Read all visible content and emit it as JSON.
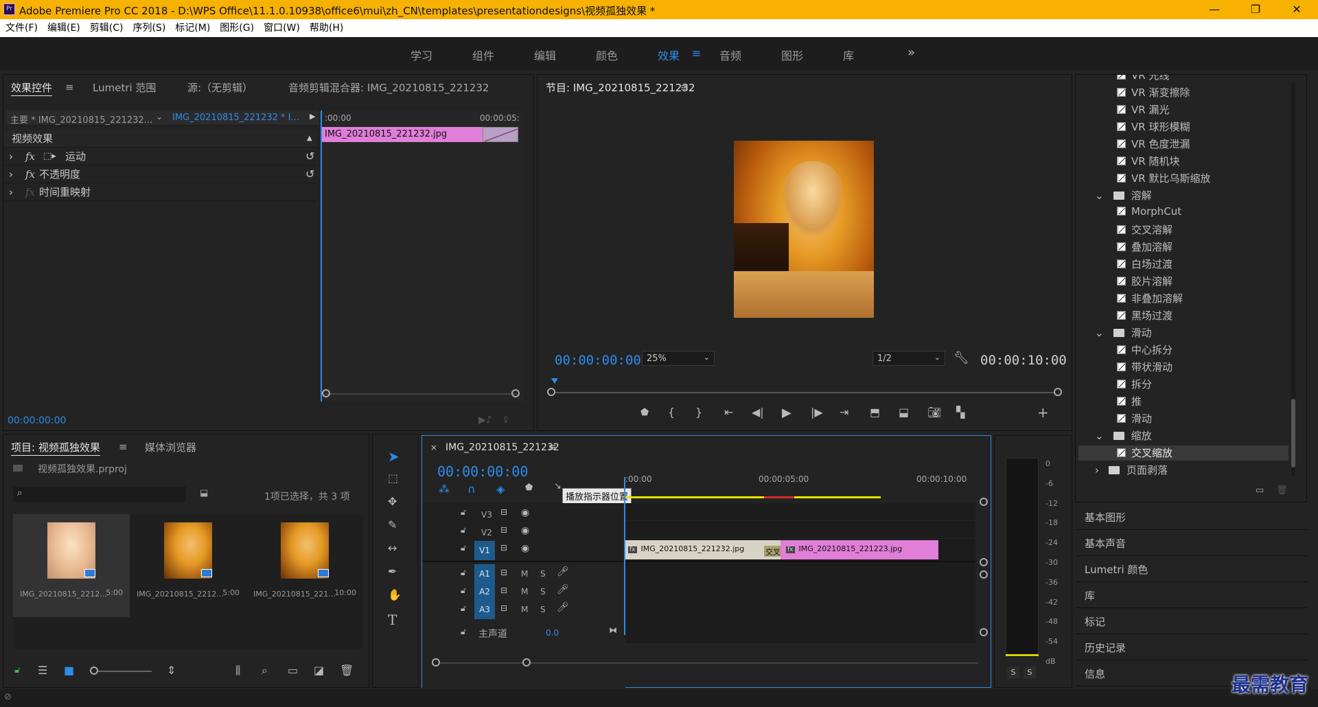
{
  "app": {
    "title": "Adobe Premiere Pro CC 2018 - D:\\WPS Office\\11.1.0.10938\\office6\\mui\\zh_CN\\templates\\presentationdesigns\\视频孤独效果 *",
    "icon_label": "Pr"
  },
  "menu": [
    "文件(F)",
    "编辑(E)",
    "剪辑(C)",
    "序列(S)",
    "标记(M)",
    "图形(G)",
    "窗口(W)",
    "帮助(H)"
  ],
  "workspaces": [
    "学习",
    "组件",
    "编辑",
    "颜色",
    "效果",
    "音频",
    "图形",
    "库"
  ],
  "active_workspace": "效果",
  "more_glyph": "»",
  "effect_controls": {
    "tabs": [
      "效果控件",
      "Lumetri 范围",
      "源:（无剪辑）",
      "音频剪辑混合器: IMG_20210815_221232"
    ],
    "master_label": "主要 * IMG_20210815_221232...",
    "clip_dropdown": "IMG_20210815_221232 * I...",
    "ruler_start": ":00:00",
    "ruler_end": "00:00:05:",
    "clip_name": "IMG_20210815_221232.jpg",
    "section": "视频效果",
    "effects": [
      "运动",
      "不透明度",
      "时间重映射"
    ],
    "timecode": "00:00:00:00"
  },
  "program_monitor": {
    "title": "节目: IMG_20210815_221232",
    "timecode": "00:00:00:00",
    "zoom": "25%",
    "resolution": "1/2",
    "duration": "00:00:10:00"
  },
  "effects_tree": {
    "vr_items": [
      "VR 光线",
      "VR 渐变擦除",
      "VR 漏光",
      "VR 球形模糊",
      "VR 色度泄漏",
      "VR 随机块",
      "VR 默比乌斯缩放"
    ],
    "folders": [
      {
        "name": "溶解",
        "items": [
          "MorphCut",
          "交叉溶解",
          "叠加溶解",
          "白场过渡",
          "胶片溶解",
          "非叠加溶解",
          "黑场过渡"
        ]
      },
      {
        "name": "滑动",
        "items": [
          "中心拆分",
          "带状滑动",
          "拆分",
          "推",
          "滑动"
        ]
      },
      {
        "name": "缩放",
        "items": [
          "交叉缩放"
        ]
      },
      {
        "name": "页面剥落",
        "items": []
      }
    ],
    "selected_item": "交叉缩放"
  },
  "side_panels": [
    "基本图形",
    "基本声音",
    "Lumetri 颜色",
    "库",
    "标记",
    "历史记录",
    "信息"
  ],
  "project": {
    "tabs": [
      "项目: 视频孤独效果",
      "媒体浏览器"
    ],
    "file": "视频孤独效果.prproj",
    "selection_info": "1项已选择，共 3 项",
    "items": [
      {
        "name": "IMG_20210815_2212...",
        "duration": "5:00"
      },
      {
        "name": "IMG_20210815_2212...",
        "duration": "5:00"
      },
      {
        "name": "IMG_20210815_221...",
        "duration": "10:00"
      }
    ]
  },
  "timeline": {
    "sequence_name": "IMG_20210815_221232",
    "timecode": "00:00:00:00",
    "tooltip": "播放指示器位置",
    "ruler": [
      ":00:00",
      "00:00:05:00",
      "00:00:10:00"
    ],
    "video_tracks": [
      "V3",
      "V2",
      "V1"
    ],
    "audio_tracks": [
      "A1",
      "A2",
      "A3"
    ],
    "master_label": "主声道",
    "master_value": "0.0",
    "clip1": "IMG_20210815_221232.jpg",
    "clip2": "IMG_20210815_221223.jpg",
    "transition": "交叉缩",
    "mute_label": "M",
    "solo_label": "S"
  },
  "audio_meter": {
    "scale": [
      "0",
      "-6",
      "-12",
      "-18",
      "-24",
      "-30",
      "-36",
      "-42",
      "-48",
      "-54",
      "dB"
    ],
    "solo_labels": [
      "S",
      "S"
    ]
  },
  "watermark": "最需教育",
  "colors": {
    "accent": "#2d8ceb",
    "titlebar": "#f7b100",
    "clip_pink": "#e07ed8",
    "workarea": "#e4e400"
  }
}
